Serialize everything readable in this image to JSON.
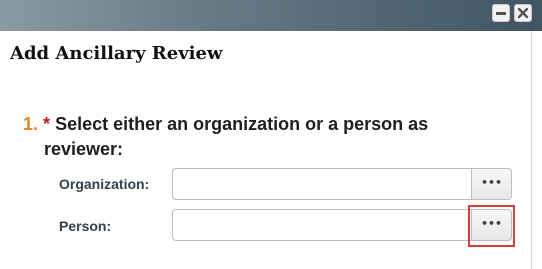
{
  "window": {
    "title": "Add Ancillary Review",
    "controls": {
      "minimize_icon": "minimize-icon",
      "close_icon": "close-icon"
    }
  },
  "question": {
    "number": "1.",
    "required_marker": "*",
    "text_line1": "Select either an organization or a person as",
    "text_line2": "reviewer:"
  },
  "fields": {
    "organization": {
      "label": "Organization:",
      "value": "",
      "button_label": "•••"
    },
    "person": {
      "label": "Person:",
      "value": "",
      "button_label": "•••"
    }
  },
  "colors": {
    "titlebar_gradient_start": "#8a9aa2",
    "titlebar_gradient_end": "#3f5563",
    "question_number": "#e08a1e",
    "required_marker": "#c01818",
    "highlight": "#d93a3a"
  }
}
